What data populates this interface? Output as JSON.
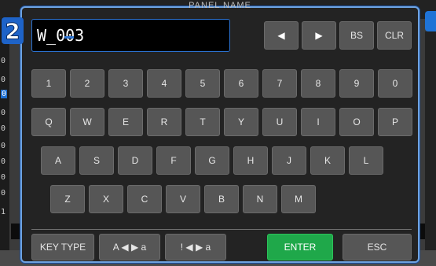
{
  "dialog": {
    "title": "PANEL NAME",
    "step_number": "2",
    "name_value": "W_003"
  },
  "background": {
    "side_items": [
      "0",
      "0",
      "0",
      "0",
      "0",
      "0",
      "0",
      "0",
      "0",
      "1"
    ]
  },
  "keyboard": {
    "nav": {
      "left": "◀",
      "right": "▶",
      "bs": "BS",
      "clr": "CLR"
    },
    "digits": [
      "1",
      "2",
      "3",
      "4",
      "5",
      "6",
      "7",
      "8",
      "9",
      "0"
    ],
    "row_q": [
      "Q",
      "W",
      "E",
      "R",
      "T",
      "Y",
      "U",
      "I",
      "O",
      "P"
    ],
    "row_a": [
      "A",
      "S",
      "D",
      "F",
      "G",
      "H",
      "J",
      "K",
      "L"
    ],
    "row_z": [
      "Z",
      "X",
      "C",
      "V",
      "B",
      "N",
      "M"
    ],
    "bottom": {
      "key_type": "KEY TYPE",
      "case_toggle": "A ◀ ▶ a",
      "symbol_toggle": "! ◀ ▶ a",
      "enter": "ENTER",
      "esc": "ESC"
    }
  },
  "colors": {
    "accent": "#2c73d2",
    "enter": "#1fa84a",
    "key": "#565656"
  }
}
